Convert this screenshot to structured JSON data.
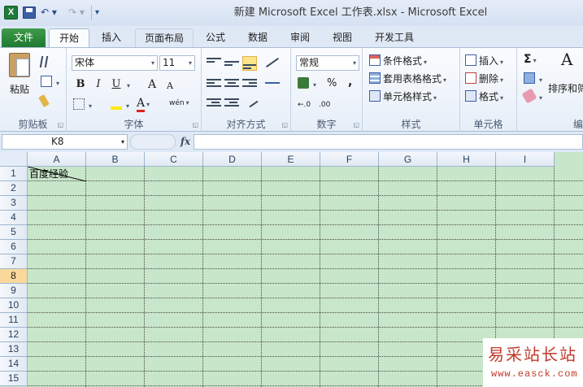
{
  "window": {
    "title": "新建 Microsoft Excel 工作表.xlsx - Microsoft Excel",
    "app_icon": "X"
  },
  "quick_access": {
    "undo": "↶ ▾",
    "redo": "↷ ▾",
    "customize": "▾"
  },
  "tabs": [
    "文件",
    "开始",
    "插入",
    "页面布局",
    "公式",
    "数据",
    "审阅",
    "视图",
    "开发工具"
  ],
  "ribbon": {
    "clipboard": {
      "label": "剪贴板",
      "paste": "粘贴"
    },
    "font": {
      "label": "字体",
      "name": "宋体",
      "size": "11",
      "bold": "B",
      "italic": "I",
      "underline": "U",
      "grow": "A",
      "shrink": "A",
      "font_color": "A",
      "wen": "wén"
    },
    "alignment": {
      "label": "对齐方式"
    },
    "number": {
      "label": "数字",
      "format": "常规",
      "percent": "%",
      "comma": ",",
      "inc_decimal": "←.0",
      "dec_decimal": ".00"
    },
    "styles": {
      "label": "样式",
      "conditional": "条件格式",
      "table": "套用表格格式",
      "cell": "单元格样式"
    },
    "cells": {
      "label": "单元格",
      "insert": "插入",
      "delete": "删除",
      "format": "格式"
    },
    "editing": {
      "sigma": "Σ",
      "sort": "排序和筛",
      "label_partial": "编"
    }
  },
  "formula_bar": {
    "name_box": "K8",
    "fx": "fx",
    "content": ""
  },
  "sheet": {
    "columns": [
      "A",
      "B",
      "C",
      "D",
      "E",
      "F",
      "G",
      "H",
      "I"
    ],
    "rows": [
      "1",
      "2",
      "3",
      "4",
      "5",
      "6",
      "7",
      "8",
      "9",
      "10",
      "11",
      "12",
      "13",
      "14",
      "15"
    ],
    "active_row": "8",
    "a1_text": "百度经验",
    "grid_color": "#c8e6c9"
  },
  "watermark": {
    "title": "易采站长站",
    "url": "www.easck.com"
  }
}
